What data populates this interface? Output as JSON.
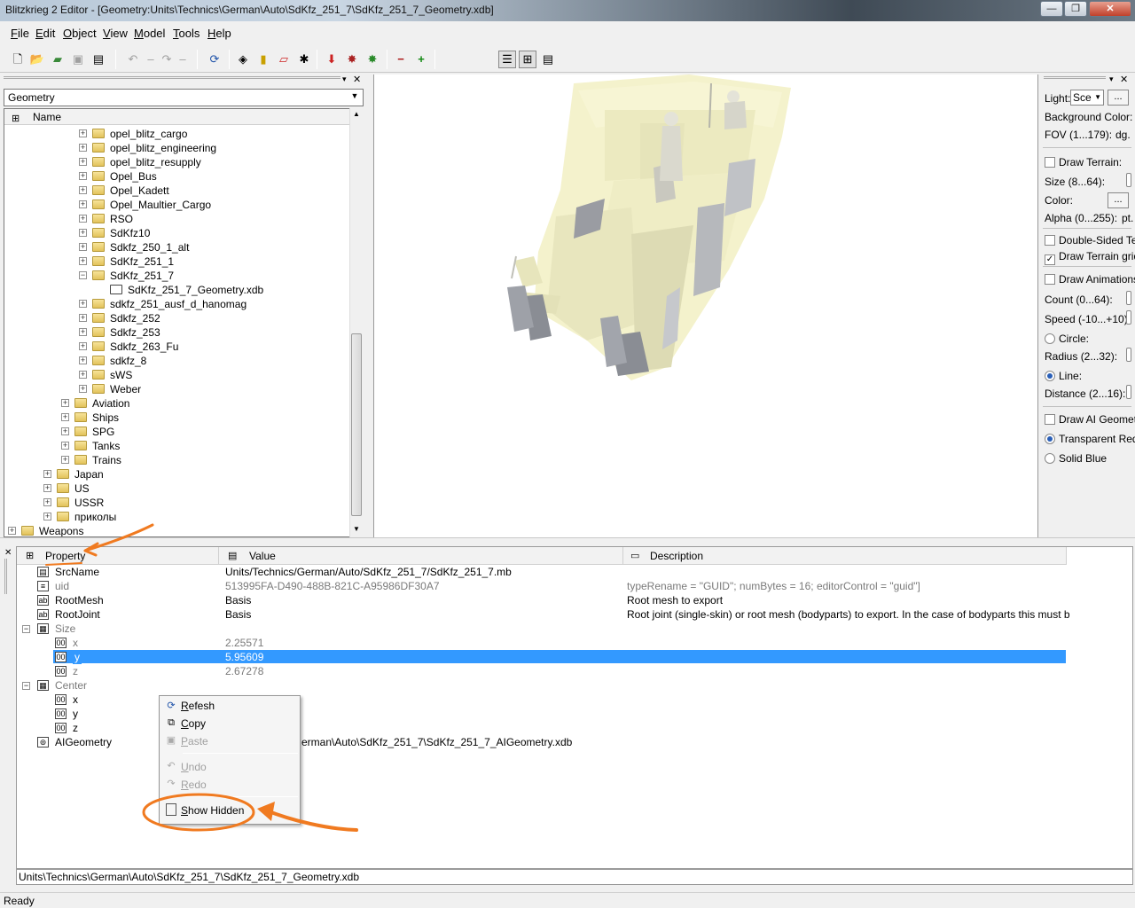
{
  "window": {
    "title": "Blitzkrieg 2 Editor - [Geometry:Units\\Technics\\German\\Auto\\SdKfz_251_7\\SdKfz_251_7_Geometry.xdb]",
    "min_glyph": "—",
    "max_glyph": "❐",
    "close_glyph": "✕"
  },
  "menu": [
    "File",
    "Edit",
    "Object",
    "View",
    "Model",
    "Tools",
    "Help"
  ],
  "left_panel": {
    "combo_value": "Geometry",
    "tree_header": "Name",
    "tree_items": [
      {
        "label": "opel_blitz_cargo",
        "level": 2,
        "type": "folder",
        "toggle": "+"
      },
      {
        "label": "opel_blitz_engineering",
        "level": 2,
        "type": "folder",
        "toggle": "+"
      },
      {
        "label": "opel_blitz_resupply",
        "level": 2,
        "type": "folder",
        "toggle": "+"
      },
      {
        "label": "Opel_Bus",
        "level": 2,
        "type": "folder",
        "toggle": "+"
      },
      {
        "label": "Opel_Kadett",
        "level": 2,
        "type": "folder",
        "toggle": "+"
      },
      {
        "label": "Opel_Maultier_Cargo",
        "level": 2,
        "type": "folder",
        "toggle": "+"
      },
      {
        "label": "RSO",
        "level": 2,
        "type": "folder",
        "toggle": "+"
      },
      {
        "label": "SdKfz10",
        "level": 2,
        "type": "folder",
        "toggle": "+"
      },
      {
        "label": "Sdkfz_250_1_alt",
        "level": 2,
        "type": "folder",
        "toggle": "+"
      },
      {
        "label": "SdKfz_251_1",
        "level": 2,
        "type": "folder",
        "toggle": "+"
      },
      {
        "label": "SdKfz_251_7",
        "level": 2,
        "type": "folder",
        "toggle": "−"
      },
      {
        "label": "SdKfz_251_7_Geometry.xdb",
        "level": 3,
        "type": "file",
        "toggle": ""
      },
      {
        "label": "sdkfz_251_ausf_d_hanomag",
        "level": 2,
        "type": "folder",
        "toggle": "+"
      },
      {
        "label": "Sdkfz_252",
        "level": 2,
        "type": "folder",
        "toggle": "+"
      },
      {
        "label": "Sdkfz_253",
        "level": 2,
        "type": "folder",
        "toggle": "+"
      },
      {
        "label": "Sdkfz_263_Fu",
        "level": 2,
        "type": "folder",
        "toggle": "+"
      },
      {
        "label": "sdkfz_8",
        "level": 2,
        "type": "folder",
        "toggle": "+"
      },
      {
        "label": "sWS",
        "level": 2,
        "type": "folder",
        "toggle": "+"
      },
      {
        "label": "Weber",
        "level": 2,
        "type": "folder",
        "toggle": "+"
      },
      {
        "label": "Aviation",
        "level": 1,
        "type": "folder",
        "toggle": "+"
      },
      {
        "label": "Ships",
        "level": 1,
        "type": "folder",
        "toggle": "+"
      },
      {
        "label": "SPG",
        "level": 1,
        "type": "folder",
        "toggle": "+"
      },
      {
        "label": "Tanks",
        "level": 1,
        "type": "folder",
        "toggle": "+"
      },
      {
        "label": "Trains",
        "level": 1,
        "type": "folder",
        "toggle": "+"
      },
      {
        "label": "Japan",
        "level": 0,
        "type": "folder",
        "toggle": "+"
      },
      {
        "label": "US",
        "level": 0,
        "type": "folder",
        "toggle": "+"
      },
      {
        "label": "USSR",
        "level": 0,
        "type": "folder",
        "toggle": "+"
      },
      {
        "label": "приколы",
        "level": 0,
        "type": "folder",
        "toggle": "+"
      },
      {
        "label": "Weapons",
        "level": -1,
        "type": "folder",
        "toggle": "+"
      }
    ]
  },
  "right_panel": {
    "light_label": "Light:",
    "light_value": "Sce",
    "ellipsis": "...",
    "background_color": "Background Color:",
    "fov": "FOV (1...179):",
    "fov_unit": "dg.",
    "draw_terrain": "Draw Terrain:",
    "size": "Size (8...64):",
    "color": "Color:",
    "alpha": "Alpha (0...255):",
    "alpha_unit": "pt.",
    "double_sided": "Double-Sided Te",
    "draw_terrain_grid": "Draw Terrain grid",
    "draw_animations": "Draw Animations:",
    "count": "Count (0...64):",
    "speed": "Speed (-10...+10):",
    "circle": "Circle:",
    "radius": "Radius (2...32):",
    "line": "Line:",
    "distance": "Distance (2...16):",
    "draw_ai_geometry": "Draw AI Geometr",
    "transparent_red": "Transparent Red",
    "solid_blue": "Solid Blue",
    "checked_glyph": "✓"
  },
  "properties": {
    "headers": {
      "property": "Property",
      "value": "Value",
      "description": "Description"
    },
    "rows": [
      {
        "name": "SrcName",
        "value": "Units/Technics/German/Auto/SdKfz_251_7/SdKfz_251_7.mb",
        "desc": "",
        "icon": "▤"
      },
      {
        "name": "uid",
        "value": "513995FA-D490-488B-821C-A95986DF30A7",
        "desc": "typeRename = \"GUID\"; numBytes = 16; editorControl = \"guid\"]",
        "icon": "≡"
      },
      {
        "name": "RootMesh",
        "value": "Basis",
        "desc": "Root mesh to export",
        "icon": "ab"
      },
      {
        "name": "RootJoint",
        "value": "Basis",
        "desc": "Root joint (single-skin) or root mesh (bodyparts) to export. In the case of bodyparts this must be equal t...",
        "icon": "ab"
      },
      {
        "name": "Size",
        "value": "",
        "desc": "",
        "icon": "▦"
      },
      {
        "name": "x",
        "value": "2.25571",
        "desc": "",
        "icon": "00"
      },
      {
        "name": "y",
        "value": "5.95609",
        "desc": "",
        "icon": "00"
      },
      {
        "name": "z",
        "value": "2.67278",
        "desc": "",
        "icon": "00"
      },
      {
        "name": "Center",
        "value": "",
        "desc": "",
        "icon": "▦"
      },
      {
        "name": "x",
        "value": "",
        "desc": "",
        "icon": "00"
      },
      {
        "name": "y",
        "value": "",
        "desc": "",
        "icon": "00"
      },
      {
        "name": "z",
        "value": "",
        "desc": "",
        "icon": "00"
      },
      {
        "name": "AIGeometry",
        "value": "erman\\Auto\\SdKfz_251_7\\SdKfz_251_7_AIGeometry.xdb",
        "desc": "",
        "icon": "⊚"
      }
    ],
    "toggle_minus": "−"
  },
  "context_menu": {
    "refresh": "Refesh",
    "copy": "Copy",
    "paste": "Paste",
    "undo": "Undo",
    "redo": "Redo",
    "show_hidden": "Show Hidden"
  },
  "status_path": "Units\\Technics\\German\\Auto\\SdKfz_251_7\\SdKfz_251_7_Geometry.xdb",
  "status_bar": "Ready",
  "colors": {
    "selection": "#3399ff",
    "annotation": "#f07a20",
    "model": "#f5f3d0"
  }
}
